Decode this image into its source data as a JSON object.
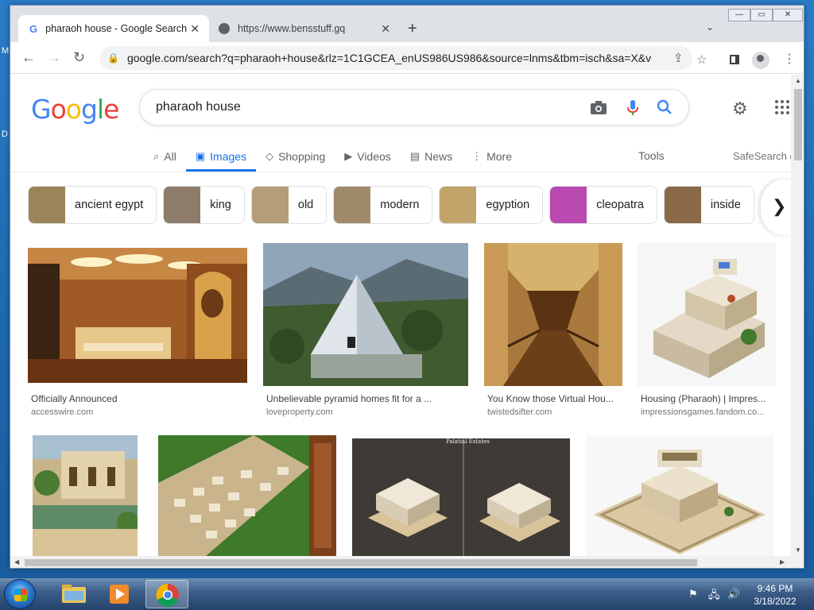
{
  "desktop": {
    "letters": [
      "M",
      "D"
    ]
  },
  "window": {
    "tabs": [
      {
        "title": "pharaoh house - Google Search",
        "active": true
      },
      {
        "title": "https://www.bensstuff.gq",
        "active": false
      }
    ],
    "controls": {
      "minimize": "—",
      "maximize": "▭",
      "close": "✕"
    },
    "address": "google.com/search?q=pharaoh+house&rlz=1C1GCEA_enUS986US986&source=lnms&tbm=isch&sa=X&ve..."
  },
  "google": {
    "logo_letters": [
      {
        "ch": "G",
        "color": "#4285f4"
      },
      {
        "ch": "o",
        "color": "#ea4335"
      },
      {
        "ch": "o",
        "color": "#fbbc05"
      },
      {
        "ch": "g",
        "color": "#4285f4"
      },
      {
        "ch": "l",
        "color": "#34a853"
      },
      {
        "ch": "e",
        "color": "#ea4335"
      }
    ],
    "query": "pharaoh house",
    "search_tabs": [
      {
        "label": "All",
        "icon": "search-icon",
        "active": false
      },
      {
        "label": "Images",
        "icon": "image-icon",
        "active": true
      },
      {
        "label": "Shopping",
        "icon": "tag-icon",
        "active": false
      },
      {
        "label": "Videos",
        "icon": "play-icon",
        "active": false
      },
      {
        "label": "News",
        "icon": "news-icon",
        "active": false
      },
      {
        "label": "More",
        "icon": "kebab-icon",
        "active": false
      }
    ],
    "tools": "Tools",
    "safesearch": "SafeSearch o",
    "chips": [
      {
        "label": "ancient egypt",
        "color": "#9b8457"
      },
      {
        "label": "king",
        "color": "#8d7c69"
      },
      {
        "label": "old",
        "color": "#b59d78"
      },
      {
        "label": "modern",
        "color": "#a08a6c"
      },
      {
        "label": "egyption",
        "color": "#c2a46b"
      },
      {
        "label": "cleopatra",
        "color": "#b84ab0"
      },
      {
        "label": "inside",
        "color": "#8a6a46"
      }
    ],
    "results_row1": [
      {
        "caption": "Officially Announced",
        "source": "accesswire.com"
      },
      {
        "caption": "Unbelievable pyramid homes fit for a ...",
        "source": "loveproperty.com"
      },
      {
        "caption": "You Know those Virtual Hou...",
        "source": "twistedsifter.com"
      },
      {
        "caption": "Housing (Pharaoh) | Impres...",
        "source": "impressionsgames.fandom.co..."
      }
    ],
    "results_row2_image_label": "Palatial Estates"
  },
  "taskbar": {
    "time": "9:46 PM",
    "date": "3/18/2022"
  }
}
